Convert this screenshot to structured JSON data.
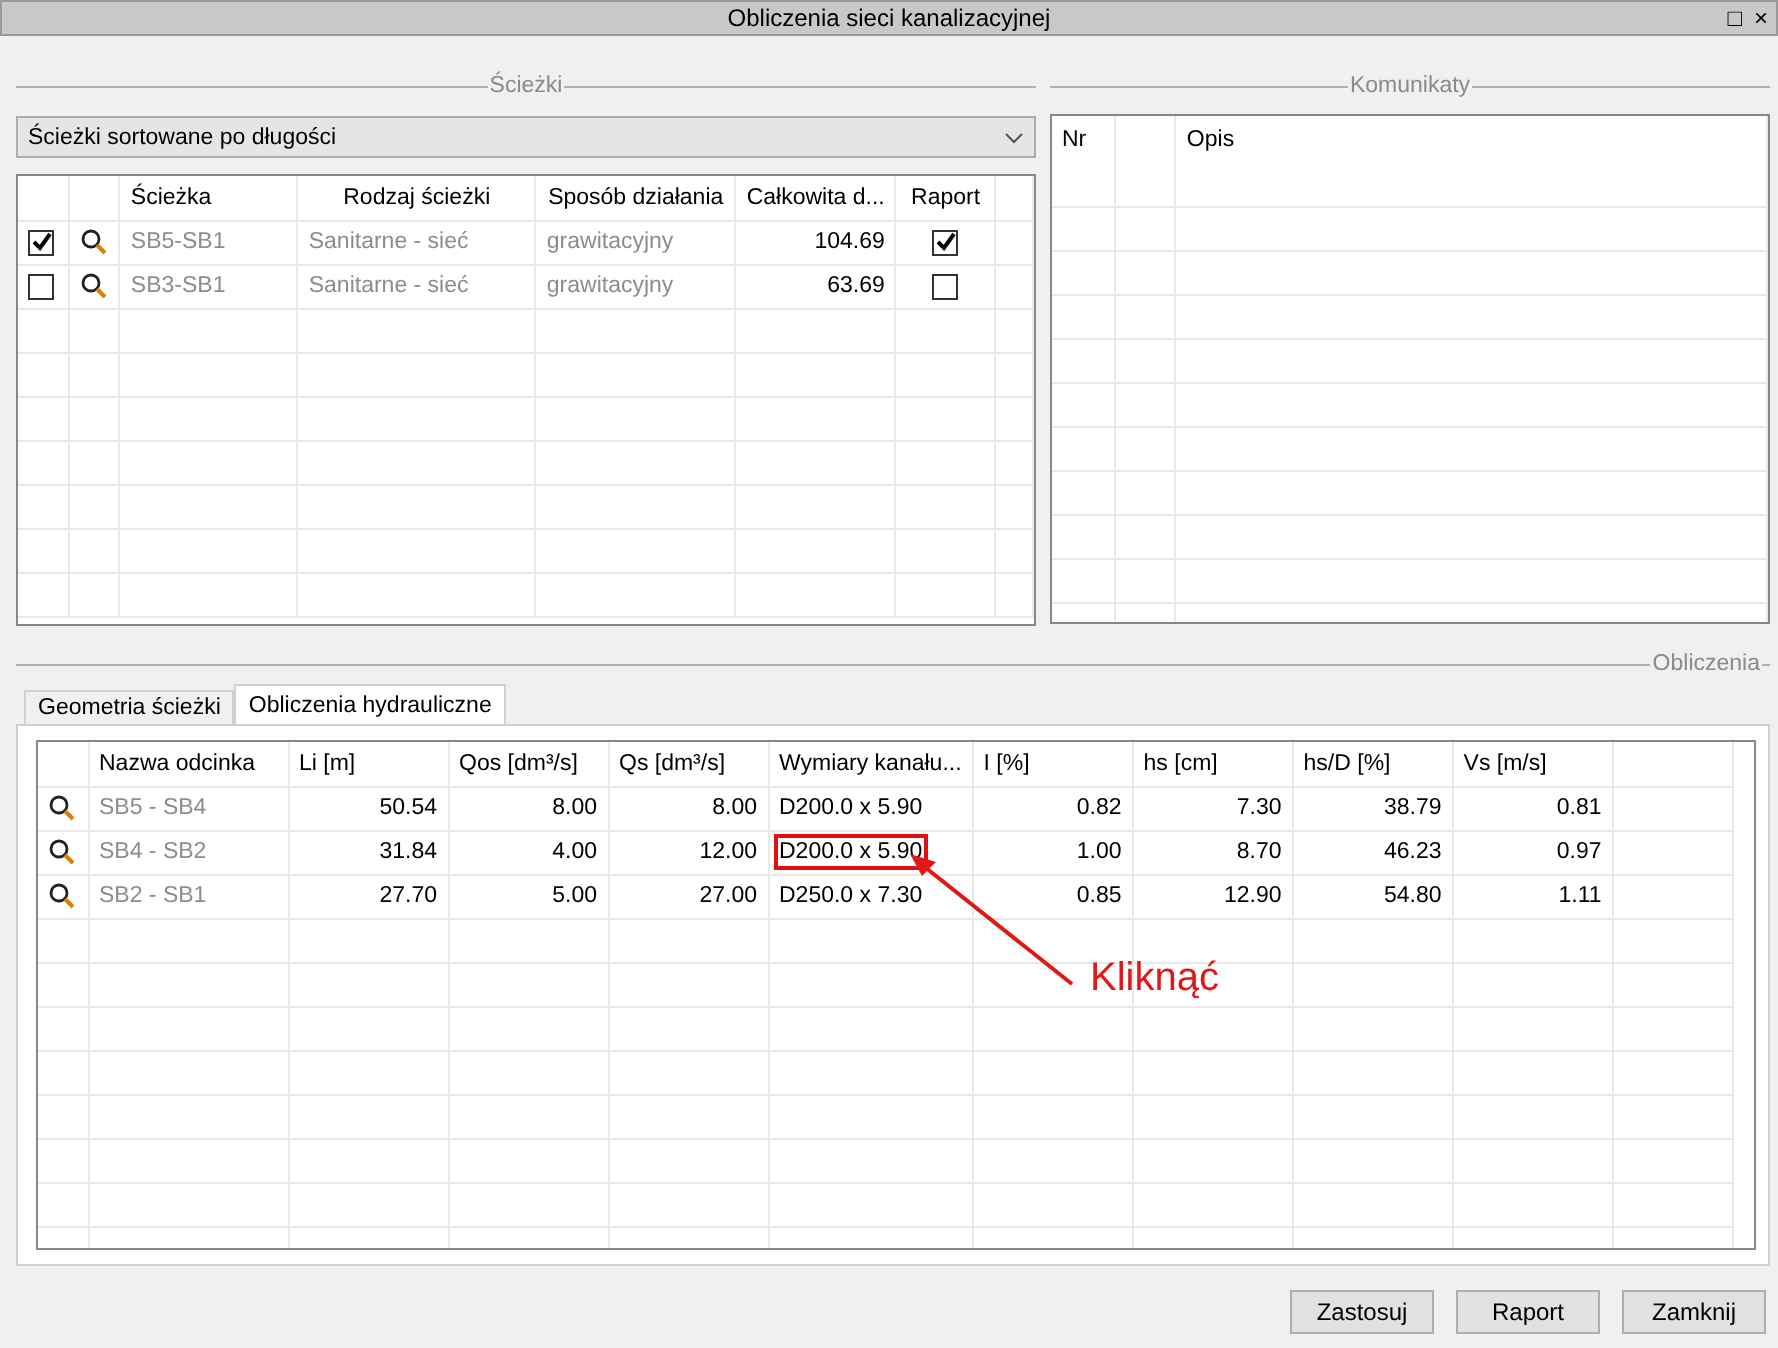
{
  "window": {
    "title": "Obliczenia sieci kanalizacyjnej",
    "controls": [
      "□",
      "×"
    ]
  },
  "paths_group": {
    "title": "Ścieżki",
    "dropdown": "Ścieżki sortowane po długości",
    "columns": [
      "Ścieżka",
      "Rodzaj ścieżki",
      "Sposób działania",
      "Całkowita d...",
      "Raport"
    ],
    "rows": [
      {
        "checked": true,
        "path": "SB5-SB1",
        "type": "Sanitarne - sieć",
        "mode": "grawitacyjny",
        "length": "104.69",
        "report": true
      },
      {
        "checked": false,
        "path": "SB3-SB1",
        "type": "Sanitarne - sieć",
        "mode": "grawitacyjny",
        "length": "63.69",
        "report": false
      }
    ]
  },
  "messages_group": {
    "title": "Komunikaty",
    "columns": [
      "Nr",
      "Opis"
    ]
  },
  "calc_group": {
    "title": "Obliczenia",
    "tabs": [
      {
        "label": "Geometria ścieżki",
        "selected": false
      },
      {
        "label": "Obliczenia hydrauliczne",
        "selected": true
      }
    ],
    "columns": [
      "Nazwa odcinka",
      "Li [m]",
      "Qos [dm³/s]",
      "Qs [dm³/s]",
      "Wymiary kanału...",
      "I [%]",
      "hs [cm]",
      "hs/D [%]",
      "Vs [m/s]"
    ],
    "rows": [
      {
        "cells": [
          "SB5 - SB4",
          "50.54",
          "8.00",
          "8.00",
          "D200.0 x 5.90",
          "0.82",
          "7.30",
          "38.79",
          "0.81"
        ],
        "dimension_marked": false
      },
      {
        "cells": [
          "SB4 - SB2",
          "31.84",
          "4.00",
          "12.00",
          "D200.0 x 5.90",
          "1.00",
          "8.70",
          "46.23",
          "0.97"
        ],
        "dimension_marked": true
      },
      {
        "cells": [
          "SB2 - SB1",
          "27.70",
          "5.00",
          "27.00",
          "D250.0 x 7.30",
          "0.85",
          "12.90",
          "54.80",
          "1.11"
        ],
        "dimension_marked": false
      }
    ],
    "annotation": "Kliknąć"
  },
  "buttons": [
    "Zastosuj",
    "Raport",
    "Zamknij"
  ]
}
